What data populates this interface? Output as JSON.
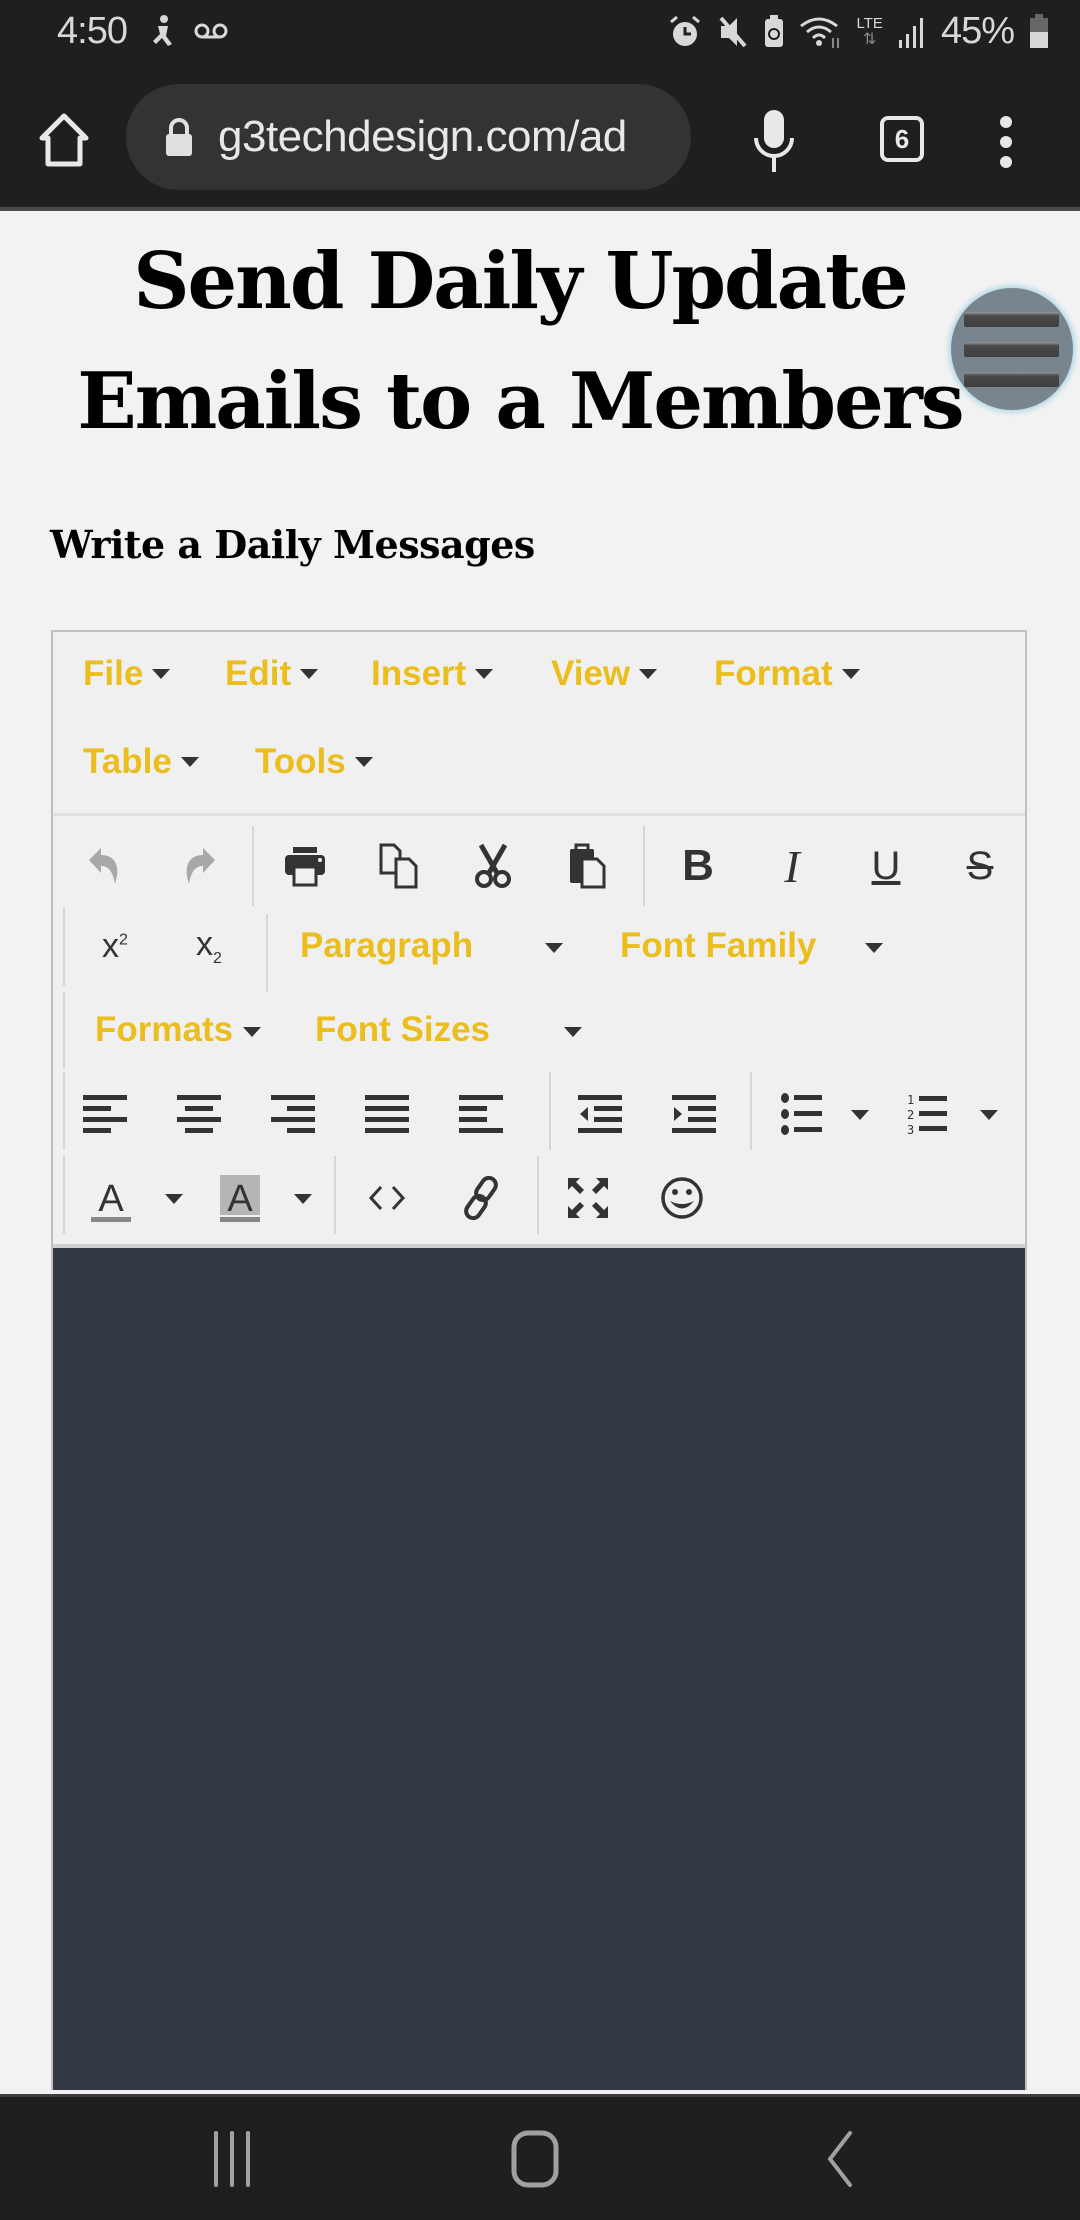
{
  "status_bar": {
    "time": "4:50",
    "left_icons": [
      "accessibility-icon",
      "voicemail-icon"
    ],
    "right_icons": [
      "alarm-icon",
      "mute-icon",
      "battery-saver-icon",
      "wifi-icon",
      "lte-icon",
      "signal-icon"
    ],
    "lte_label": "LTE",
    "battery_percent": "45%"
  },
  "browser": {
    "url": "g3techdesign.com/ad",
    "tab_count": "6"
  },
  "page": {
    "title": "Send Daily Update Emails to a Members",
    "section_heading": "Write a Daily Messages"
  },
  "editor": {
    "menu": [
      {
        "label": "File"
      },
      {
        "label": "Edit"
      },
      {
        "label": "Insert"
      },
      {
        "label": "View"
      },
      {
        "label": "Format"
      },
      {
        "label": "Table"
      },
      {
        "label": "Tools"
      }
    ],
    "dropdowns": {
      "block_format": "Paragraph",
      "font_family": "Font Family",
      "formats": "Formats",
      "font_sizes": "Font Sizes"
    },
    "toolbar_buttons": [
      "undo",
      "redo",
      "print",
      "copy",
      "cut",
      "paste",
      "bold",
      "italic",
      "underline",
      "strikethrough",
      "superscript",
      "subscript",
      "align-left",
      "align-center",
      "align-right",
      "align-justify",
      "align-none",
      "outdent",
      "indent",
      "bullet-list",
      "numbered-list",
      "text-color",
      "background-color",
      "source-code",
      "link",
      "fullscreen",
      "emoticons"
    ],
    "content": "",
    "colors": {
      "accent": "#ebbd1d",
      "content_bg": "#313743",
      "toolbar_bg": "#f0f0f0"
    }
  }
}
